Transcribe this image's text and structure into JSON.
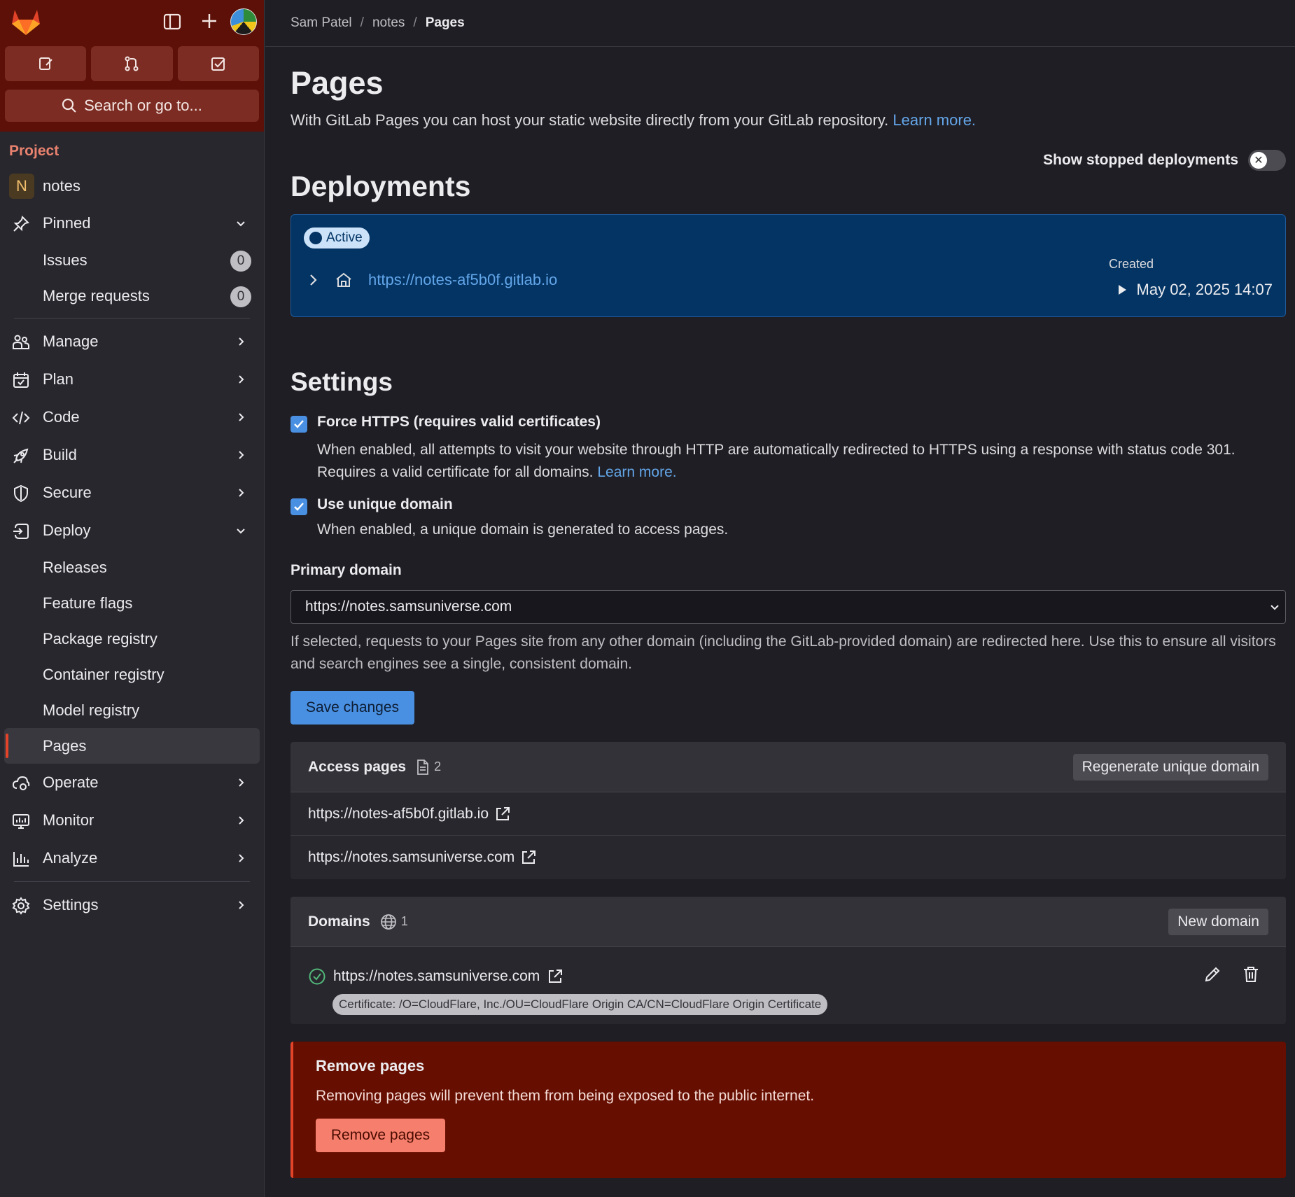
{
  "sidebar": {
    "search_label": "Search or go to...",
    "section_label": "Project",
    "project": {
      "initial": "N",
      "name": "notes"
    },
    "pinned": {
      "label": "Pinned",
      "items": [
        {
          "label": "Issues",
          "count": "0"
        },
        {
          "label": "Merge requests",
          "count": "0"
        }
      ]
    },
    "groups": [
      {
        "label": "Manage"
      },
      {
        "label": "Plan"
      },
      {
        "label": "Code"
      },
      {
        "label": "Build"
      },
      {
        "label": "Secure"
      }
    ],
    "deploy": {
      "label": "Deploy",
      "items": [
        "Releases",
        "Feature flags",
        "Package registry",
        "Container registry",
        "Model registry",
        "Pages"
      ]
    },
    "groups2": [
      {
        "label": "Operate"
      },
      {
        "label": "Monitor"
      },
      {
        "label": "Analyze"
      }
    ],
    "settings_label": "Settings"
  },
  "breadcrumb": {
    "user": "Sam Patel",
    "project": "notes",
    "current": "Pages",
    "sep": "/"
  },
  "page": {
    "title": "Pages",
    "description": "With GitLab Pages you can host your static website directly from your GitLab repository.",
    "learn_more": "Learn more.",
    "show_stopped_label": "Show stopped deployments",
    "show_stopped_on": false
  },
  "deployments": {
    "title": "Deployments",
    "status": "Active",
    "url": "https://notes-af5b0f.gitlab.io",
    "created_label": "Created",
    "created_value": "May 02, 2025 14:07"
  },
  "settings": {
    "title": "Settings",
    "force_https": {
      "label": "Force HTTPS (requires valid certificates)",
      "checked": true,
      "help": "When enabled, all attempts to visit your website through HTTP are automatically redirected to HTTPS using a response with status code 301. Requires a valid certificate for all domains.",
      "learn_more": "Learn more."
    },
    "unique_domain": {
      "label": "Use unique domain",
      "checked": true,
      "help": "When enabled, a unique domain is generated to access pages."
    },
    "primary_domain": {
      "label": "Primary domain",
      "value": "https://notes.samsuniverse.com",
      "help": "If selected, requests to your Pages site from any other domain (including the GitLab-provided domain) are redirected here. Use this to ensure all visitors and search engines see a single, consistent domain."
    },
    "save_label": "Save changes"
  },
  "access_pages": {
    "title": "Access pages",
    "count": "2",
    "button": "Regenerate unique domain",
    "urls": [
      "https://notes-af5b0f.gitlab.io",
      "https://notes.samsuniverse.com"
    ]
  },
  "domains": {
    "title": "Domains",
    "count": "1",
    "button": "New domain",
    "items": [
      {
        "url": "https://notes.samsuniverse.com",
        "certificate": "Certificate: /O=CloudFlare, Inc./OU=CloudFlare Origin CA/CN=CloudFlare Origin Certificate"
      }
    ]
  },
  "remove": {
    "title": "Remove pages",
    "description": "Removing pages will prevent them from being exposed to the public internet.",
    "button": "Remove pages"
  },
  "colors": {
    "accent": "#4a90e2",
    "brand": "#e24329",
    "danger_bg": "#660e00",
    "sidebar_top": "#5c1007"
  }
}
